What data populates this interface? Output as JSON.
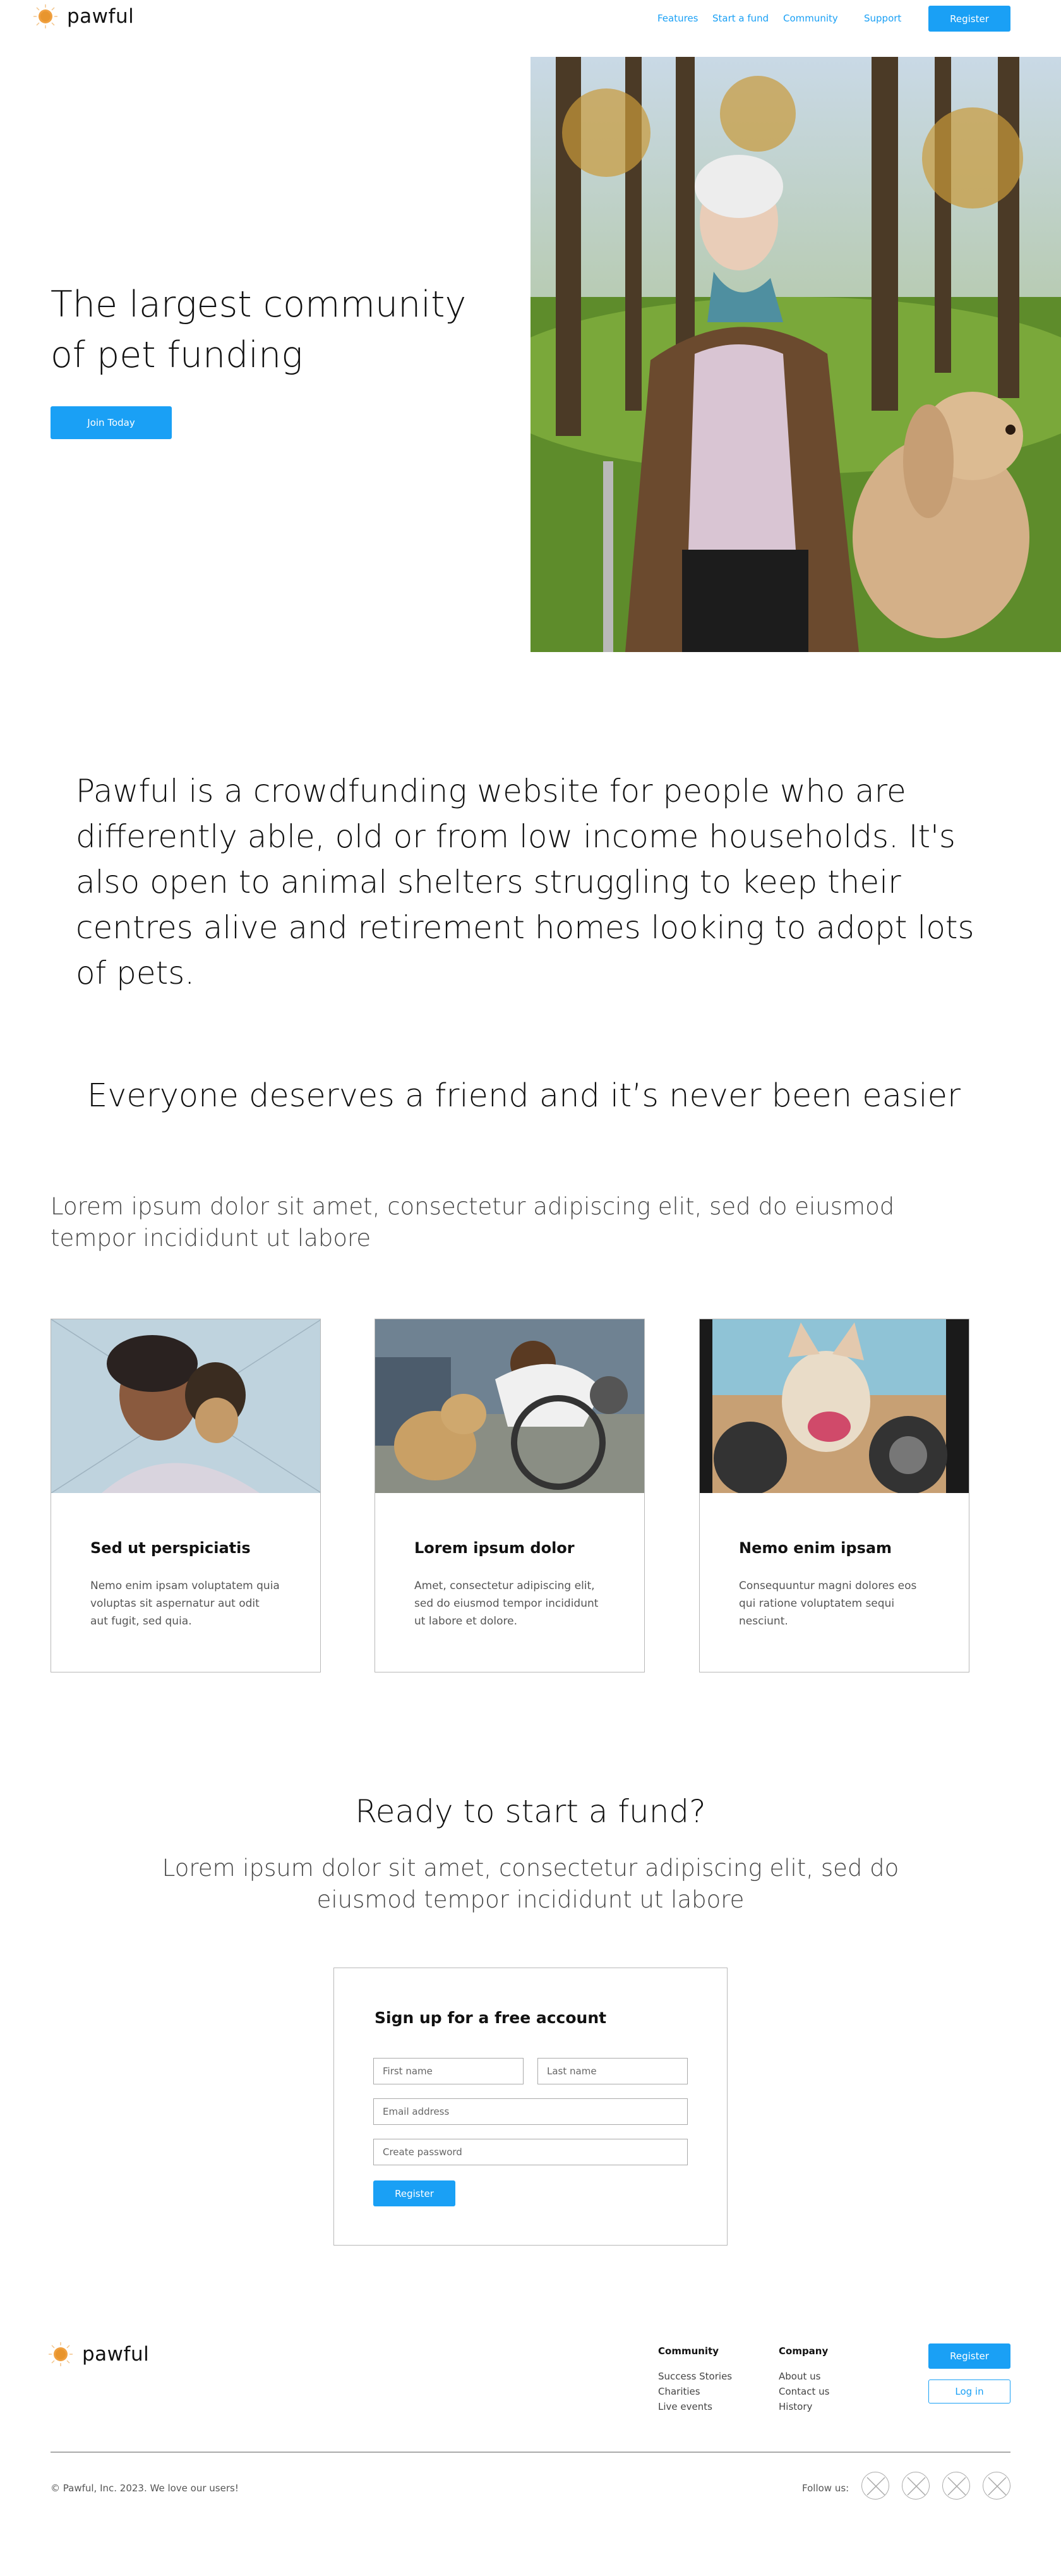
{
  "header": {
    "logo_text": "pawful",
    "nav": [
      "Features",
      "Start a fund",
      "Community",
      "Support"
    ],
    "register_label": "Register"
  },
  "hero": {
    "title": "The largest community of pet funding",
    "cta_label": "Join Today"
  },
  "about": {
    "text": "Pawful is a crowdfunding website for people who are differently able, old or from low income households. It's also open to animal shelters struggling to keep their centres alive and retirement homes looking to adopt lots of pets."
  },
  "friend": {
    "heading": "Everyone deserves a friend and it’s never been easier",
    "subtext": "Lorem ipsum dolor sit amet, consectetur adipiscing elit, sed do eiusmod tempor incididunt ut labore"
  },
  "cards": [
    {
      "title": "Sed ut perspiciatis",
      "text": "Nemo enim ipsam voluptatem quia voluptas sit aspernatur aut odit aut fugit, sed quia."
    },
    {
      "title": "Lorem ipsum dolor",
      "text": "Amet, consectetur adipiscing elit, sed do eiusmod tempor incididunt ut labore et dolore."
    },
    {
      "title": "Nemo enim ipsam",
      "text": "Consequuntur magni dolores eos qui ratione voluptatem sequi nesciunt."
    }
  ],
  "ready": {
    "heading": "Ready to start a fund?",
    "subtext": "Lorem ipsum dolor sit amet, consectetur adipiscing elit, sed do eiusmod tempor incididunt ut labore"
  },
  "signup": {
    "title": "Sign up for a free account",
    "first_name_placeholder": "First name",
    "last_name_placeholder": "Last name",
    "email_placeholder": "Email address",
    "password_placeholder": "Create password",
    "register_label": "Register"
  },
  "footer": {
    "logo_text": "pawful",
    "community_title": "Community",
    "community_links": [
      "Success Stories",
      "Charities",
      "Live events"
    ],
    "company_title": "Company",
    "company_links": [
      "About us",
      "Contact us",
      "History"
    ],
    "register_label": "Register",
    "login_label": "Log in",
    "copyright": "© Pawful, Inc. 2023. We love our users!",
    "follow_label": "Follow us:"
  },
  "colors": {
    "accent": "#1aa0f5",
    "logo_orange": "#f0a040"
  }
}
